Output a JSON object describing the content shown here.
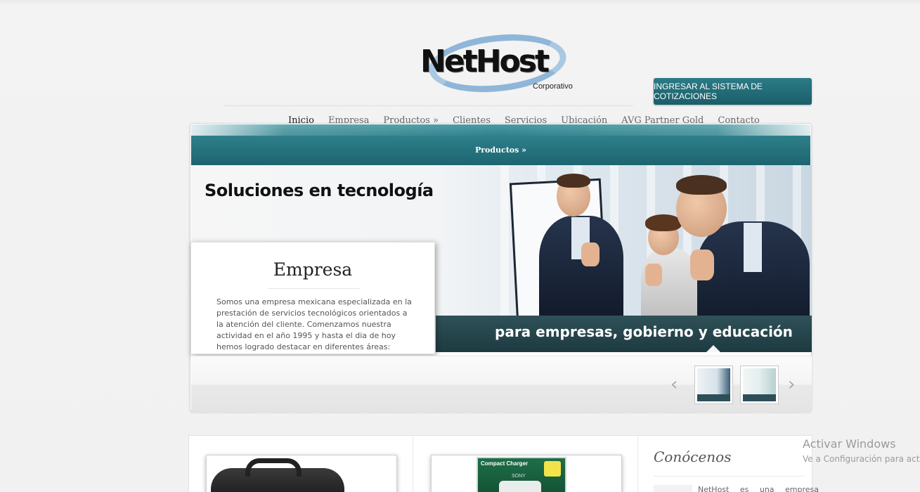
{
  "header": {
    "logo_text": "NetHost",
    "logo_subtitle": "Corporativo",
    "quote_button_label": "INGRESAR AL SISTEMA DE COTIZACIONES"
  },
  "nav": {
    "items": [
      {
        "label": "Inicio",
        "active": true
      },
      {
        "label": "Empresa"
      },
      {
        "label": "Productos »"
      },
      {
        "label": "Clientes"
      },
      {
        "label": "Servicios"
      },
      {
        "label": "Ubicación"
      },
      {
        "label": "AVG Partner Gold"
      },
      {
        "label": "Contacto"
      }
    ]
  },
  "slider": {
    "bar_label": "Productos »",
    "heading": "Soluciones en tecnología",
    "caption": "para empresas, gobierno y educación",
    "card": {
      "title": "Empresa",
      "text": "Somos una empresa mexicana especializada en la prestación de servicios tecnológicos orientados a la atención del cliente. Comenzamos nuestra actividad en el año 1995 y hasta el dia de hoy hemos logrado destacar en diferentes áreas: Administración, diseño e"
    },
    "prev_arrow": "‹",
    "next_arrow": "›"
  },
  "products": {
    "charger_label": "Compact Charger",
    "charger_brand": "SONY"
  },
  "sidebar": {
    "title": "Conócenos",
    "text": "NetHost es una empresa"
  },
  "watermark": {
    "title": "Activar Windows",
    "subtitle": "Ve a Configuración para act"
  },
  "colors": {
    "accent_teal": "#1d6570",
    "button_teal": "#1a5e69",
    "page_bg": "#f1f1f1"
  }
}
